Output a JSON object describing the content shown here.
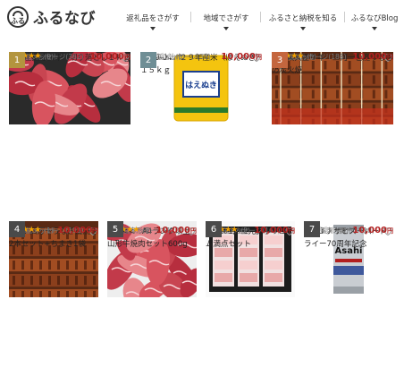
{
  "header": {
    "logo_mark": "ふる",
    "logo_text": "ふるなび",
    "nav": [
      "返礼品をさがす",
      "地域でさがす",
      "ふるさと納税を知る",
      "ふるなびBlog"
    ]
  },
  "products": [
    {
      "rank": "1",
      "location": "福岡県 久留米市",
      "title": "九州産黒毛和牛　切り落とし１ｋｇ",
      "messages_label": "応援メッセージ",
      "messages_count": "(362)",
      "rating": 4.5,
      "reviews": "(9)",
      "price": "10,000",
      "price_unit": "円",
      "image_icon": "beef-slices"
    },
    {
      "rank": "2",
      "location": "山形県 上山市",
      "title": "0059-04　２９年産米（はえぬき）１５ｋｇ",
      "messages_label": "応援メッセージ",
      "messages_count": "(33)",
      "rating": 0,
      "reviews": "(0)",
      "price": "10,000",
      "price_unit": "円",
      "image_icon": "rice-bag",
      "rice_label": "はえぬき"
    },
    {
      "rank": "3",
      "location": "愛知県 碧南市",
      "title": "A.創業大正９年　三河一色産うなぎの炭火焼",
      "messages_label": "応援メッセージ",
      "messages_count": "(186)",
      "rating": 4.5,
      "reviews": "(5)",
      "price": "10,000",
      "price_unit": "円",
      "image_icon": "grilled-eel"
    },
    {
      "rank": "4",
      "location": "高知県 四万十町",
      "title": "N-01 四万十うなぎ蒲焼き2本セット+ちまき1袋",
      "messages_label": "応援メッセージ",
      "messages_count": "(193)",
      "rating": 5,
      "reviews": "(1)",
      "price": "10,000",
      "price_unit": "円",
      "image_icon": "eel-kabayaki"
    },
    {
      "rank": "5",
      "location": "山形県 舟形町",
      "title": "700<<　A4ランク以上　山形牛焼肉セット600g",
      "messages_label": "応援メッセージ",
      "messages_count": "(120)",
      "rating": 4.5,
      "reviews": "(7)",
      "price": "10,000",
      "price_unit": "円",
      "image_icon": "wagyu-yakiniku"
    },
    {
      "rank": "6",
      "location": "山形県 庄内町",
      "title": "【A201】三元豚ボリューム満点セット",
      "messages_label": "応援メッセージ",
      "messages_count": "(161)",
      "rating": 5,
      "reviews": "(2)",
      "price": "10,000",
      "price_unit": "円",
      "image_icon": "pork-set"
    },
    {
      "rank": "7",
      "location": "大阪府 泉佐野市",
      "title": "B383 アサヒスーパードライー70周年記念　350ml×1ケ",
      "messages_label": "応援メッセージ",
      "messages_count": "(10)",
      "rating": 0,
      "reviews": "(0)",
      "price": "10,000",
      "price_unit": "円",
      "image_icon": "beer-can",
      "can_label": "Asahi"
    }
  ]
}
